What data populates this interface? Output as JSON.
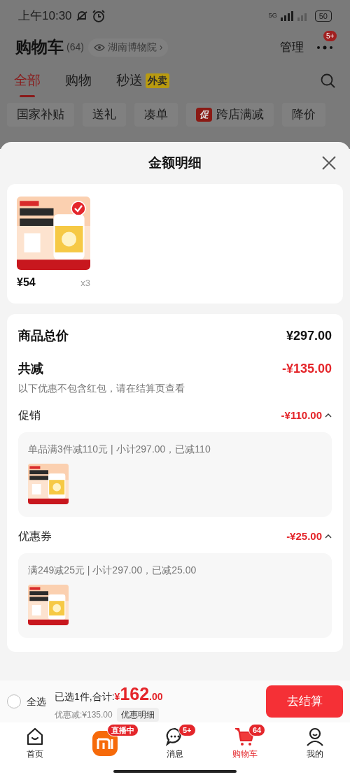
{
  "status_bar": {
    "time": "上午10:30",
    "battery": "50",
    "network": "5G"
  },
  "header": {
    "title": "购物车",
    "count": "(64)",
    "location": "湖南博物院",
    "location_chevron": "›",
    "manage": "管理",
    "menu_badge": "5+"
  },
  "tabs": [
    {
      "label": "全部",
      "selected": true
    },
    {
      "label": "购物",
      "selected": false
    },
    {
      "label": "秒送",
      "selected": false,
      "badge": "外卖"
    }
  ],
  "filters": [
    {
      "label": "国家补贴"
    },
    {
      "label": "送礼"
    },
    {
      "label": "凑单"
    },
    {
      "label": "跨店满减",
      "tag": "促"
    },
    {
      "label": "降价"
    }
  ],
  "sheet": {
    "title": "金额明细",
    "product": {
      "checked": true,
      "price": "¥54",
      "quantity": "x3"
    },
    "total": {
      "label": "商品总价",
      "value": "¥297.00"
    },
    "discount": {
      "label": "共减",
      "value": "-¥135.00",
      "note": "以下优惠不包含红包，请在结算页查看"
    },
    "groups": [
      {
        "label": "促销",
        "value": "-¥110.00",
        "expanded": true,
        "detail": "单品满3件减110元 | 小计297.00，已减110"
      },
      {
        "label": "优惠券",
        "value": "-¥25.00",
        "expanded": true,
        "detail": "满249减25元 | 小计297.00，已减25.00"
      }
    ]
  },
  "checkout": {
    "select_all": "全选",
    "select_all_checked": false,
    "summary": "已选1件,合计:",
    "currency": "¥",
    "amount": "162",
    "decimals": ".00",
    "saving": "优惠减:¥135.00",
    "detail_button": "优惠明细",
    "submit": "去结算"
  },
  "nav": [
    {
      "kind": "home",
      "label": "首页",
      "selected": false
    },
    {
      "kind": "live",
      "badge": "直播中",
      "selected": false
    },
    {
      "kind": "message",
      "label": "消息",
      "badge": "5+",
      "selected": false
    },
    {
      "kind": "cart",
      "label": "购物车",
      "badge": "64",
      "selected": true
    },
    {
      "kind": "profile",
      "label": "我的",
      "selected": false
    }
  ]
}
